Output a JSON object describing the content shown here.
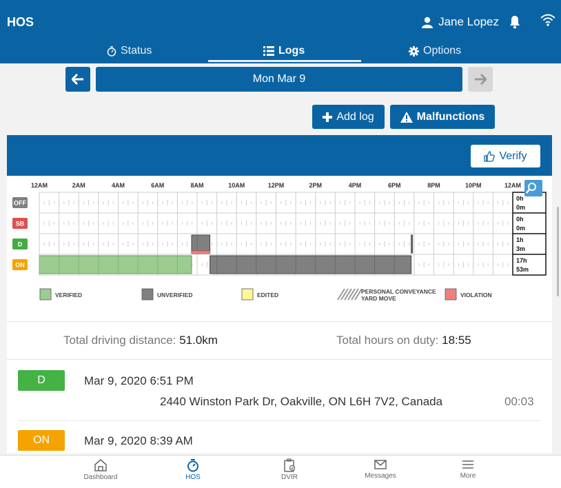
{
  "app": {
    "title": "HOS",
    "user_name": "Jane Lopez"
  },
  "tabs": [
    {
      "label": "Status",
      "icon": "stopwatch-icon"
    },
    {
      "label": "Logs",
      "icon": "list-icon"
    },
    {
      "label": "Options",
      "icon": "gear-icon"
    }
  ],
  "date_nav": {
    "date": "Mon Mar 9"
  },
  "actions": {
    "add_log": "Add log",
    "malfunctions": "Malfunctions",
    "verify": "Verify"
  },
  "chart_data": {
    "type": "timeline",
    "hour_labels": [
      "12AM",
      "2AM",
      "4AM",
      "6AM",
      "8AM",
      "10AM",
      "12PM",
      "2PM",
      "4PM",
      "6PM",
      "8PM",
      "10PM",
      "12AM"
    ],
    "rows": [
      "OFF",
      "SB",
      "D",
      "ON"
    ],
    "row_colors": [
      "#808080",
      "#e05050",
      "#44aa44",
      "#f5a300"
    ],
    "row_totals": [
      {
        "h": "0h",
        "m": "0m"
      },
      {
        "h": "0h",
        "m": "0m"
      },
      {
        "h": "1h",
        "m": "3m"
      },
      {
        "h": "17h",
        "m": "53m"
      }
    ],
    "segments": [
      {
        "row": "ON",
        "start": 0,
        "end": 7.72,
        "status": "verified"
      },
      {
        "row": "D",
        "start": 7.72,
        "end": 8.65,
        "status": "unverified"
      },
      {
        "row": "D",
        "start": 7.72,
        "end": 8.65,
        "status": "violation"
      },
      {
        "row": "ON",
        "start": 8.65,
        "end": 18.85,
        "status": "unverified"
      },
      {
        "row": "D",
        "start": 18.85,
        "end": 18.9,
        "status": "unverified"
      }
    ],
    "legend": [
      {
        "label": "VERIFIED",
        "color": "#9ccc90",
        "key": "verified"
      },
      {
        "label": "UNVERIFIED",
        "color": "#808080",
        "key": "unverified"
      },
      {
        "label": "EDITED",
        "color": "#fff79a",
        "key": "edited"
      },
      {
        "label": "PERSONAL CONVEYANCE",
        "label2": "YARD MOVE",
        "color": "#999999",
        "key": "pc"
      },
      {
        "label": "VIOLATION",
        "color": "#f08080",
        "key": "violation"
      }
    ]
  },
  "summary": {
    "distance_label": "Total driving distance:",
    "distance_value": "51.0km",
    "hours_label": "Total hours on duty:",
    "hours_value": "18:55"
  },
  "events": [
    {
      "status": "D",
      "color": "#44b244",
      "time": "Mar 9, 2020 6:51 PM",
      "location": "2440 Winston Park Dr, Oakville, ON L6H 7V2, Canada",
      "duration": "00:03"
    },
    {
      "status": "ON",
      "color": "#f5a300",
      "time": "Mar 9, 2020 8:39 AM",
      "location": "",
      "duration": ""
    }
  ],
  "bottom_nav": [
    {
      "label": "Dashboard",
      "icon": "home-icon"
    },
    {
      "label": "HOS",
      "icon": "stopwatch-icon"
    },
    {
      "label": "DVIR",
      "icon": "clipboard-icon"
    },
    {
      "label": "Messages",
      "icon": "mail-icon"
    },
    {
      "label": "More",
      "icon": "menu-icon"
    }
  ]
}
